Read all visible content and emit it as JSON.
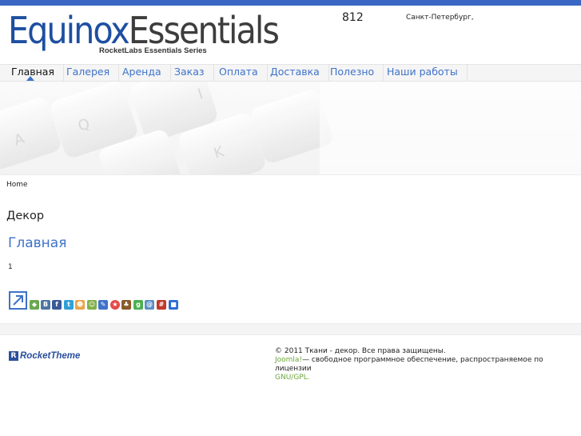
{
  "header": {
    "logo_main_left": "Equinox",
    "logo_main_right": "Essentials",
    "logo_sub": "RocketLabs Essentials Series",
    "phone": "812",
    "city": "Санкт-Петербург,"
  },
  "nav": {
    "items": [
      {
        "label": "Главная",
        "active": true
      },
      {
        "label": "Галерея"
      },
      {
        "label": "Аренда"
      },
      {
        "label": "Заказ"
      },
      {
        "label": "Оплата"
      },
      {
        "label": "Доставка"
      },
      {
        "label": "Полезно"
      },
      {
        "label": "Наши работы"
      }
    ]
  },
  "breadcrumb": "Home",
  "section_title": "Декор",
  "article": {
    "title": "Главная",
    "body": "1"
  },
  "share": {
    "icons": [
      "share-main-icon",
      "share-icon-1",
      "vkontakte-icon",
      "facebook-icon",
      "twitter-icon",
      "people-icon",
      "friends-icon",
      "pencil-icon",
      "star-icon",
      "liveinternet-icon",
      "google-icon",
      "mail-icon",
      "grid-icon",
      "delicious-icon"
    ],
    "colors": {
      "accent": "#3f72c9",
      "vk": "#4c75a3",
      "fb": "#3b5998",
      "tw": "#2fa1d9"
    }
  },
  "footer": {
    "logo_mark": "R",
    "logo_text": "RocketTheme",
    "copyright": "© 2011 Ткани - декор. Все права защищены.",
    "joomla_link": "Joomla!",
    "license_text": "— свободное программное обеспечение, распространяемое по лицензии",
    "gnu_link": "GNU/GPL."
  },
  "colors": {
    "top_bar": "#3b67c4",
    "link": "#3f72c9",
    "footer_link": "#6ba83a"
  }
}
